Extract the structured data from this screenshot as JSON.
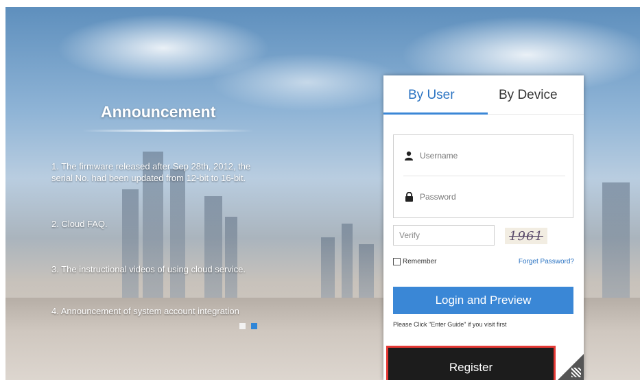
{
  "announcement": {
    "title": "Announcement",
    "items": [
      {
        "line1": "1. The firmware released after Sep 28th, 2012, the",
        "line2": "serial No. had been updated from 12-bit to 16-bit."
      },
      {
        "line1": "2. Cloud FAQ.",
        "line2": ""
      },
      {
        "line1": "3. The instructional videos of using cloud service.",
        "line2": ""
      },
      {
        "line1": "4. Announcement of system account integration",
        "line2": ""
      }
    ],
    "carousel": {
      "active_index": 1,
      "dot_colors": [
        "#f2f2f2",
        "#2f86d8"
      ]
    }
  },
  "login": {
    "tabs": [
      {
        "label": "By User",
        "active": true
      },
      {
        "label": "By Device",
        "active": false
      }
    ],
    "username_placeholder": "Username",
    "password_placeholder": "Password",
    "verify_placeholder": "Verify",
    "captcha_text": "1961",
    "remember_label": "Remember",
    "forgot_label": "Forget Password?",
    "login_button": "Login and Preview",
    "hint": "Please Click \"Enter Guide\" if you visit first",
    "register_button": "Register"
  },
  "colors": {
    "accent": "#3a87d6",
    "register_bg": "#1c1c1c",
    "highlight": "#e53935"
  },
  "icons": [
    "user-icon",
    "lock-icon",
    "qr-corner-icon"
  ]
}
